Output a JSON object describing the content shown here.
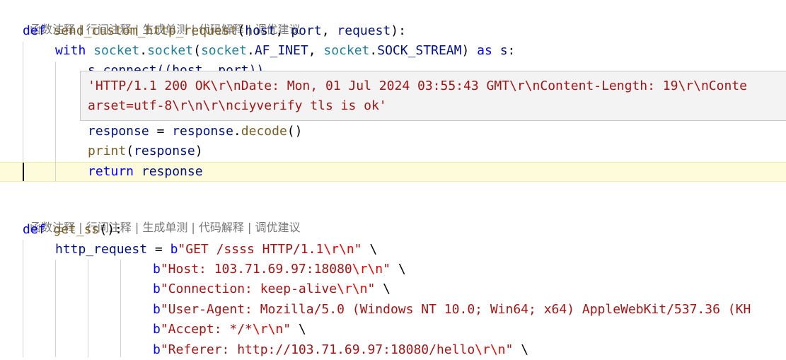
{
  "codelens": [
    "函数注释",
    "行间注释",
    "生成单测",
    "代码解释",
    "调优建议"
  ],
  "codelens_sep": " | ",
  "colors": {
    "keyword": "#0000ff",
    "function": "#795e26",
    "variable": "#001080",
    "class": "#267f99",
    "string": "#a31515",
    "escape": "#ee0000",
    "current_line": "#fdfbd9",
    "hover_bg": "#f3f3f3"
  },
  "block1": {
    "l1": {
      "def": "def",
      "name": "send_custom_http_request",
      "open": "(",
      "p1": "host",
      "c1": ", ",
      "p2": "port",
      "c2": ", ",
      "p3": "request",
      "close": "):"
    },
    "l2": {
      "with": "with",
      "sock1": "socket",
      "dot1": ".",
      "sock2": "socket",
      "open": "(",
      "sock3": "socket",
      "dot2": ".",
      "af": "AF_INET",
      "comma": ", ",
      "sock4": "socket",
      "dot3": ".",
      "stream": "SOCK_STREAM",
      "close": ")",
      "as": "as",
      "s": "s",
      "colon": ":"
    },
    "l3_partial": "s.connect((host, port))",
    "hover_line1": "'HTTP/1.1 200 OK\\r\\nDate: Mon, 01 Jul 2024 03:55:43 GMT\\r\\nContent-Length: 19\\r\\nConte",
    "hover_line2": "arset=utf-8\\r\\n\\r\\nciyverify tls is ok'",
    "l6": {
      "var": "response",
      "eq": " = ",
      "obj": "response",
      "dot": ".",
      "fn": "decode",
      "paren": "()"
    },
    "l7": {
      "fn": "print",
      "open": "(",
      "var": "response",
      "close": ")"
    },
    "l8": {
      "kw": "return",
      "var": "response"
    }
  },
  "block2": {
    "l1": {
      "def": "def",
      "name": "get_ss",
      "paren": "():"
    },
    "l2": {
      "var": "http_request",
      "eq": " = ",
      "b": "b",
      "s1": "\"GET /ssss HTTP/1.1",
      "e1": "\\r\\n",
      "q": "\"",
      "cont": " \\"
    },
    "l3": {
      "b": "b",
      "s1": "\"Host: 103.71.69.97:18080",
      "e1": "\\r\\n",
      "q": "\"",
      "cont": " \\"
    },
    "l4": {
      "b": "b",
      "s1": "\"Connection: keep-alive",
      "e1": "\\r\\n",
      "q": "\"",
      "cont": " \\"
    },
    "l5": {
      "b": "b",
      "s1": "\"User-Agent: Mozilla/5.0 (Windows NT 10.0; Win64; x64) AppleWebKit/537.36 (KH"
    },
    "l6": {
      "b": "b",
      "s1": "\"Accept: */*",
      "e1": "\\r\\n",
      "q": "\"",
      "cont": " \\"
    },
    "l7": {
      "b": "b",
      "s1": "\"Referer: http://103.71.69.97:18080/hello",
      "e1": "\\r\\n",
      "q": "\"",
      "cont": " \\"
    }
  }
}
